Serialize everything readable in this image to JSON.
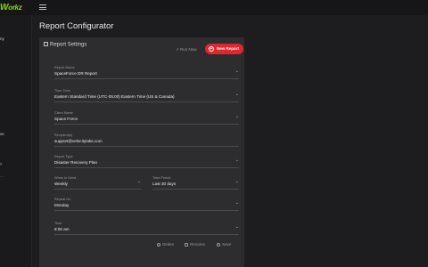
{
  "app": {
    "logo_main": "W",
    "logo_rest": "orkz"
  },
  "sidebar": {
    "fragments": [
      "ny",
      "se"
    ]
  },
  "page": {
    "title": "Report Configurator"
  },
  "card": {
    "title": "Report Settings",
    "run_now_label": "Run Now",
    "new_report_label": "New Report"
  },
  "form": {
    "report_name": {
      "label": "Report Name",
      "value": "SpaceForce DR Report"
    },
    "time_zone": {
      "label": "Time Zone",
      "value": "Eastern Standard Time (UTC-05:00) Eastern Time (US & Canada)"
    },
    "client_name": {
      "label": "Client Name",
      "value": "Space Force"
    },
    "recipient": {
      "label": "Recipient(s)",
      "value": "support@velocitylabs.com"
    },
    "report_type": {
      "label": "Report Type",
      "value": "Disaster Recovery Plan"
    },
    "when_to_send": {
      "label": "When to Send",
      "value": "Weekly"
    },
    "time_period": {
      "label": "Time Period",
      "value": "Last 30 days"
    },
    "repeat_on": {
      "label": "Repeat On",
      "value": "Monday"
    },
    "time": {
      "label": "Time",
      "value": "8:00 am"
    }
  },
  "actions": {
    "delete_label": "Delete",
    "rename_label": "Rename",
    "save_label": "Save"
  },
  "colors": {
    "accent": "#e0262e",
    "brand": "#8fd41a"
  }
}
